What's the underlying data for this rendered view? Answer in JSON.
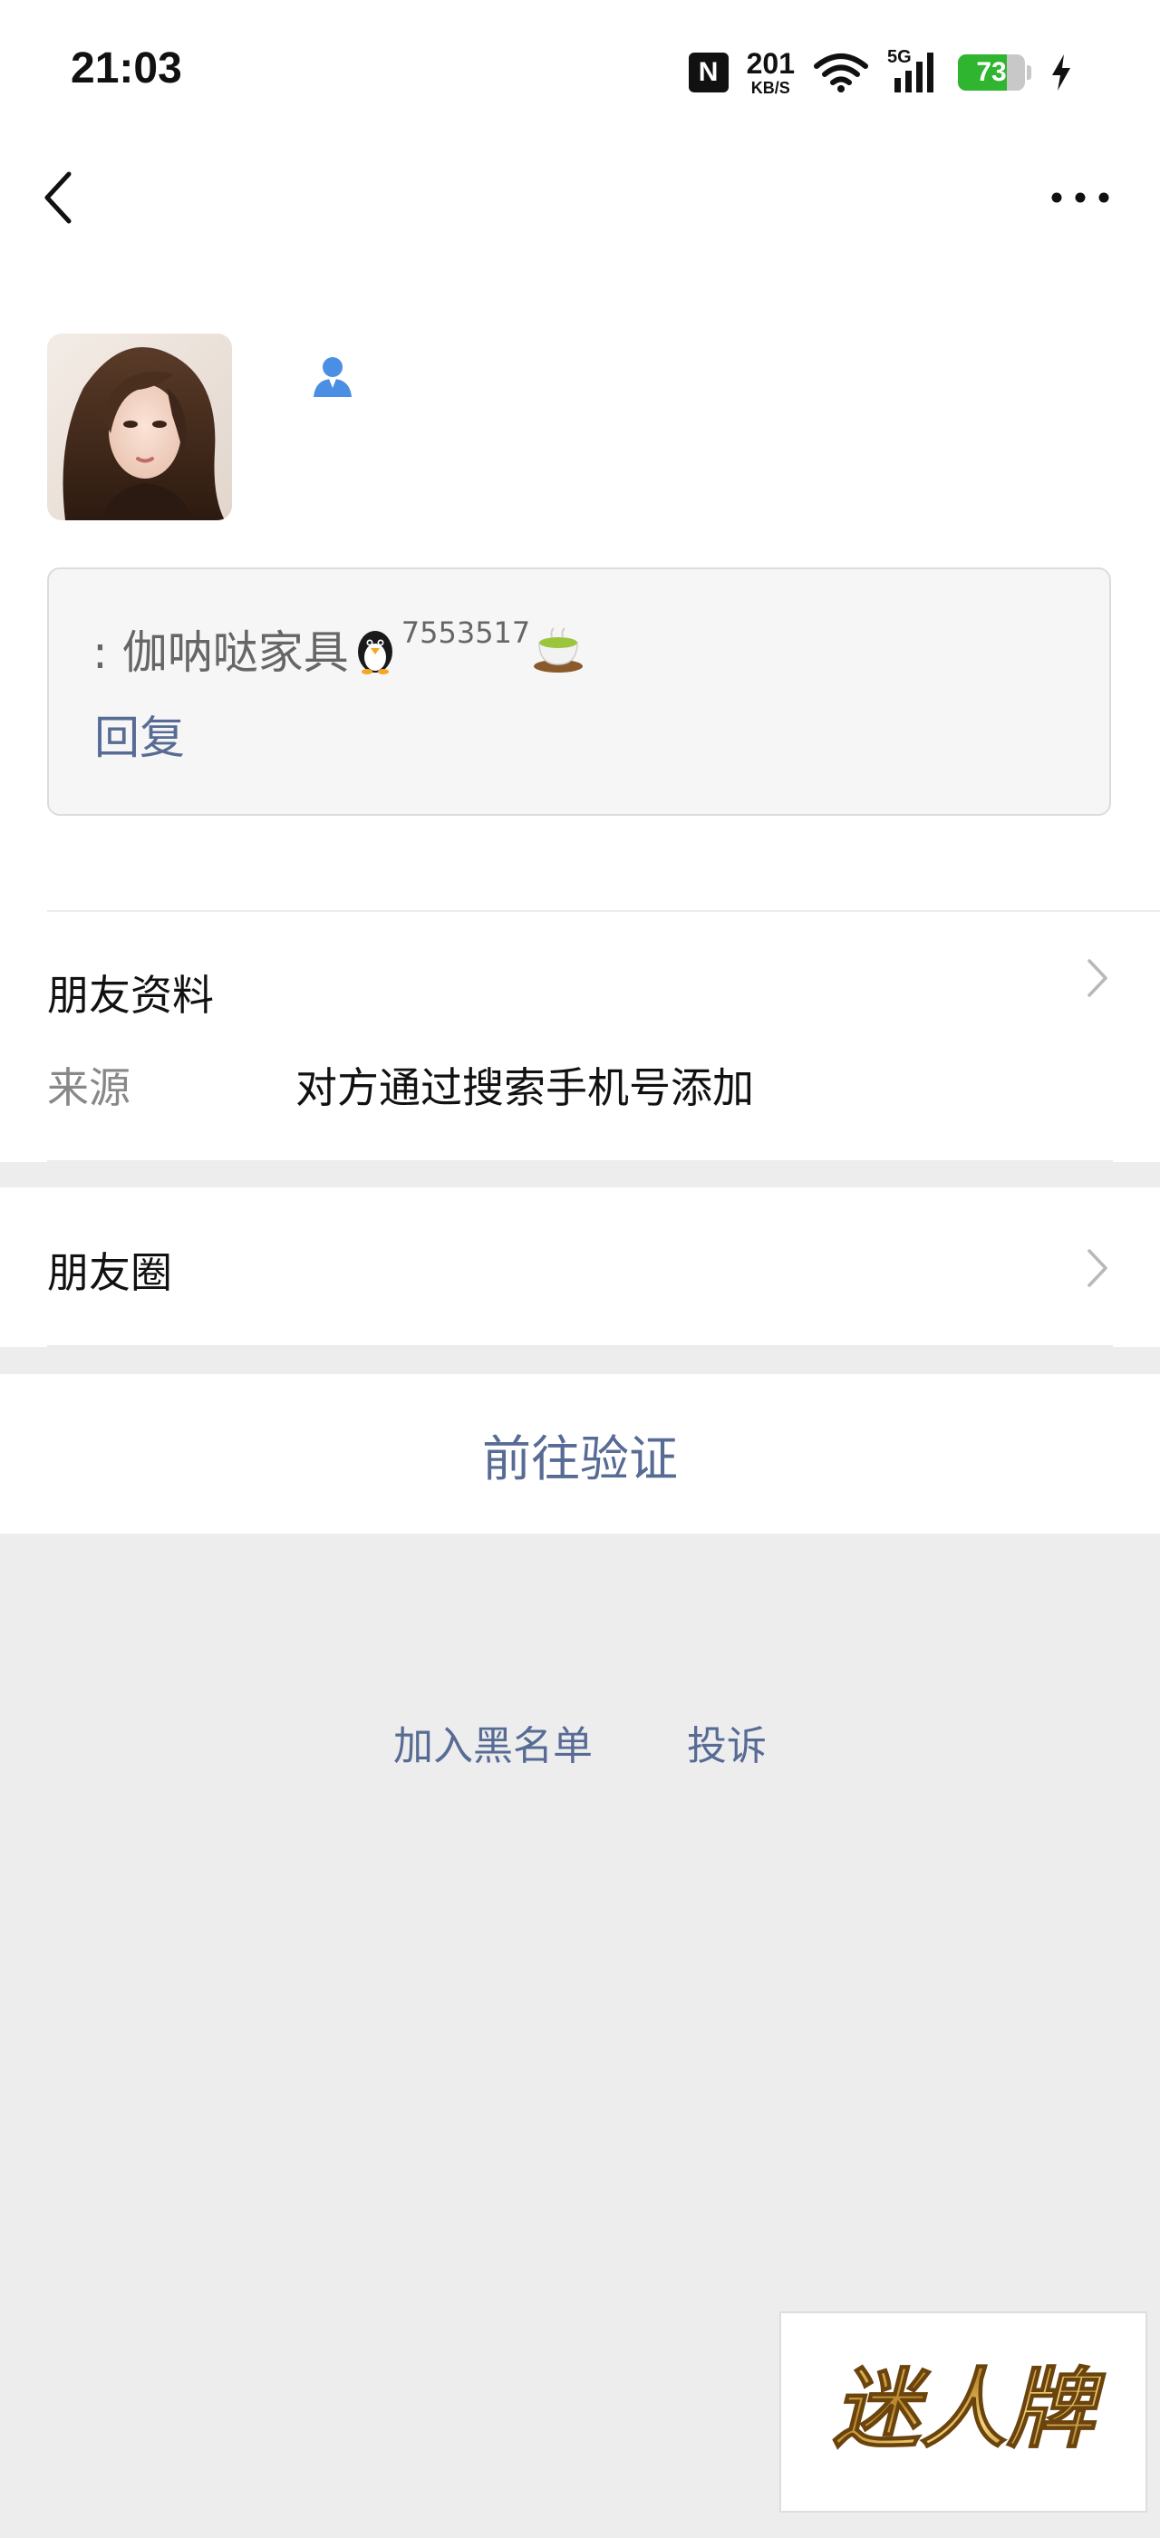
{
  "status_bar": {
    "time": "21:03",
    "nfc": "N",
    "net_speed": "201",
    "net_unit": "KB/S",
    "signal_label": "5G",
    "battery_percent": 73,
    "icons": [
      "nfc-icon",
      "wifi-icon",
      "signal-5g-icon",
      "battery-icon",
      "charging-bolt-icon"
    ]
  },
  "nav": {
    "back_icon": "chevron-left-icon",
    "more_icon": "more-dots-icon"
  },
  "profile": {
    "avatar": "avatar",
    "contact_icon": "person-icon"
  },
  "message": {
    "prefix": ": 伽呐哒家具",
    "number": "7553517",
    "emojis": [
      "penguin-emoji",
      "tea-emoji"
    ],
    "reply_label": "回复"
  },
  "friend_info": {
    "title": "朋友资料",
    "source_label": "来源",
    "source_value": "对方通过搜索手机号添加"
  },
  "moments": {
    "title": "朋友圈"
  },
  "verify": {
    "label": "前往验证"
  },
  "bottom": {
    "blacklist_label": "加入黑名单",
    "report_label": "投诉"
  },
  "watermark": {
    "text": "迷人牌"
  },
  "colors": {
    "link_blue": "#576b95",
    "battery_green": "#2fb52f",
    "background_gray": "#ededed"
  }
}
